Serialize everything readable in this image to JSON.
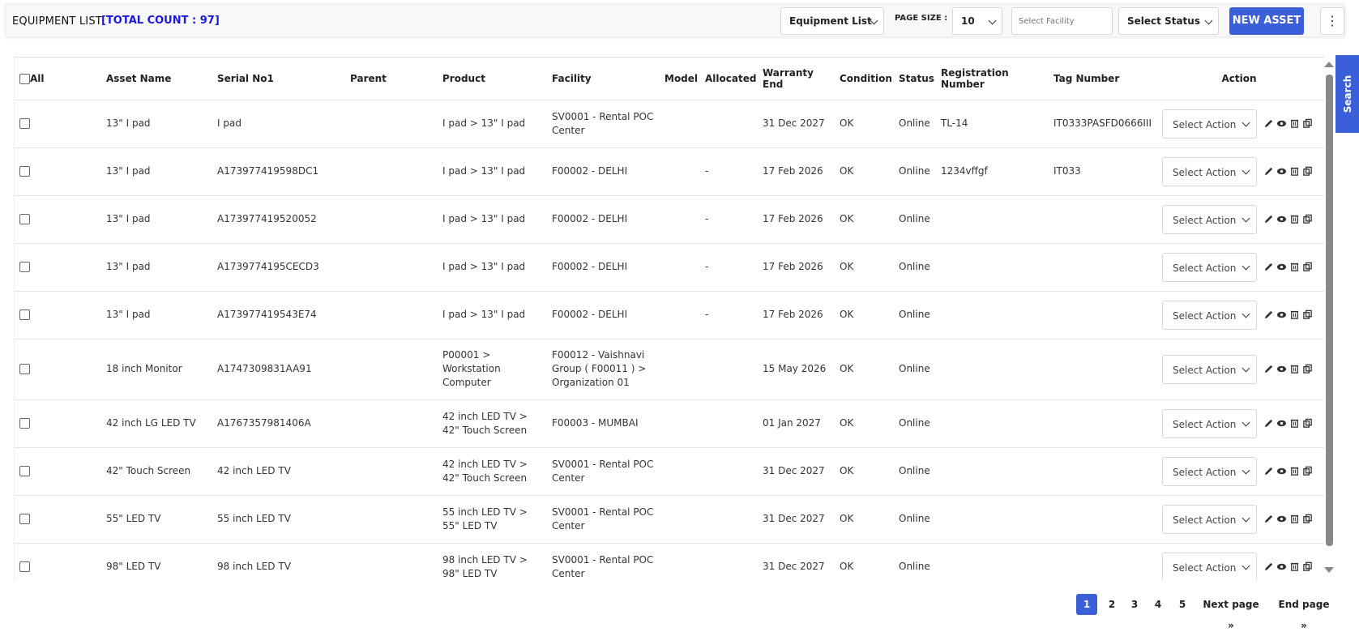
{
  "header": {
    "title": "EQUIPMENT LIST",
    "count": "[TOTAL COUNT : 97]",
    "view_select": "Equipment List",
    "page_size_label": "PAGE SIZE :",
    "page_size": "10",
    "facility_placeholder": "Select Facility",
    "status_select": "Select Status",
    "new_asset": "NEW ASSET",
    "more": "⋮"
  },
  "table": {
    "columns": [
      "All",
      "Asset Name",
      "Serial No1",
      "Parent",
      "Product",
      "Facility",
      "Model",
      "Allocated",
      "Warranty End",
      "Condition",
      "Status",
      "Registration Number",
      "Tag Number",
      "Action"
    ],
    "action_placeholder": "Select Action",
    "rows": [
      {
        "asset": "13\" I pad",
        "serial": "I pad",
        "parent": "",
        "product": "I pad > 13\" I pad",
        "facility": "SV0001 - Rental POC Center",
        "model": "",
        "allocated": "",
        "warranty": "31 Dec 2027",
        "condition": "OK",
        "status": "Online",
        "reg": "TL-14",
        "tag": "IT0333PASFD0666III"
      },
      {
        "asset": "13\" I pad",
        "serial": "A173977419598DC1",
        "parent": "",
        "product": "I pad > 13\" I pad",
        "facility": "F00002 - DELHI",
        "model": "",
        "allocated": "-",
        "warranty": "17 Feb 2026",
        "condition": "OK",
        "status": "Online",
        "reg": "1234vffgf",
        "tag": "IT033"
      },
      {
        "asset": "13\" I pad",
        "serial": "A173977419520052",
        "parent": "",
        "product": "I pad > 13\" I pad",
        "facility": "F00002 - DELHI",
        "model": "",
        "allocated": "-",
        "warranty": "17 Feb 2026",
        "condition": "OK",
        "status": "Online",
        "reg": "",
        "tag": ""
      },
      {
        "asset": "13\" I pad",
        "serial": "A1739774195CECD3",
        "parent": "",
        "product": "I pad > 13\" I pad",
        "facility": "F00002 - DELHI",
        "model": "",
        "allocated": "-",
        "warranty": "17 Feb 2026",
        "condition": "OK",
        "status": "Online",
        "reg": "",
        "tag": ""
      },
      {
        "asset": "13\" I pad",
        "serial": "A173977419543E74",
        "parent": "",
        "product": "I pad > 13\" I pad",
        "facility": "F00002 - DELHI",
        "model": "",
        "allocated": "-",
        "warranty": "17 Feb 2026",
        "condition": "OK",
        "status": "Online",
        "reg": "",
        "tag": ""
      },
      {
        "asset": "18 inch Monitor",
        "serial": "A1747309831AA91",
        "parent": "",
        "product": "P00001 > Workstation Computer",
        "facility": "F00012 - Vaishnavi Group ( F00011 ) > Organization 01",
        "model": "",
        "allocated": "",
        "warranty": "15 May 2026",
        "condition": "OK",
        "status": "Online",
        "reg": "",
        "tag": ""
      },
      {
        "asset": "42 inch LG LED TV",
        "serial": "A1767357981406A",
        "parent": "",
        "product": "42 inch LED TV > 42\" Touch Screen",
        "facility": "F00003 - MUMBAI",
        "model": "",
        "allocated": "",
        "warranty": "01 Jan 2027",
        "condition": "OK",
        "status": "Online",
        "reg": "",
        "tag": ""
      },
      {
        "asset": "42\" Touch Screen",
        "serial": "42 inch LED TV",
        "parent": "",
        "product": "42 inch LED TV > 42\" Touch Screen",
        "facility": "SV0001 - Rental POC Center",
        "model": "",
        "allocated": "",
        "warranty": "31 Dec 2027",
        "condition": "OK",
        "status": "Online",
        "reg": "",
        "tag": ""
      },
      {
        "asset": "55\" LED TV",
        "serial": "55 inch LED TV",
        "parent": "",
        "product": "55 inch LED TV > 55\" LED TV",
        "facility": "SV0001 - Rental POC Center",
        "model": "",
        "allocated": "",
        "warranty": "31 Dec 2027",
        "condition": "OK",
        "status": "Online",
        "reg": "",
        "tag": ""
      },
      {
        "asset": "98\" LED TV",
        "serial": "98 inch LED TV",
        "parent": "",
        "product": "98 inch LED TV > 98\" LED TV",
        "facility": "SV0001 - Rental POC Center",
        "model": "",
        "allocated": "",
        "warranty": "31 Dec 2027",
        "condition": "OK",
        "status": "Online",
        "reg": "",
        "tag": ""
      }
    ]
  },
  "side_tab": {
    "label": "Search"
  },
  "pagination": {
    "pages": [
      "1",
      "2",
      "3",
      "4",
      "5"
    ],
    "active": "1",
    "next": "Next page »",
    "end": "End page »"
  },
  "colors": {
    "accent": "#3a5fd9",
    "count_text": "#1a1ad6"
  },
  "icons": [
    "edit-icon",
    "view-icon",
    "delete-icon",
    "copy-icon"
  ]
}
